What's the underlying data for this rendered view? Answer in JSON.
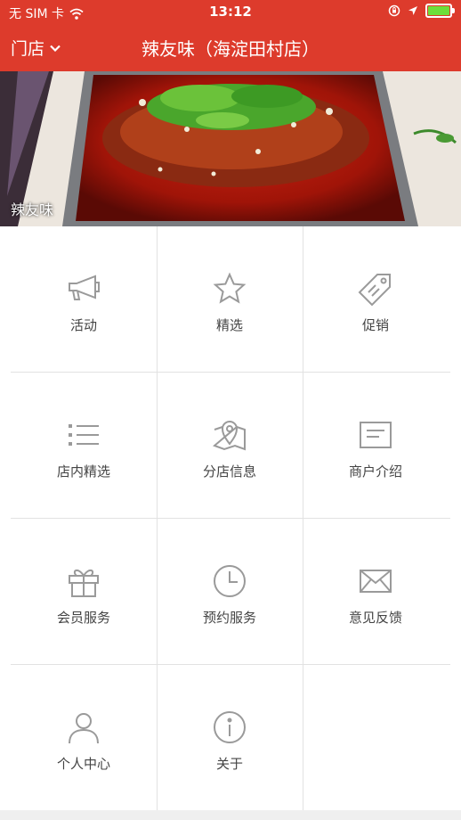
{
  "status_bar": {
    "carrier": "无 SIM 卡",
    "time": "13:12"
  },
  "nav": {
    "store_label": "门店",
    "title": "辣友味（海淀田村店）"
  },
  "banner": {
    "caption": "辣友味"
  },
  "menu": [
    {
      "label": "活动",
      "icon": "megaphone-icon"
    },
    {
      "label": "精选",
      "icon": "star-icon"
    },
    {
      "label": "促销",
      "icon": "tag-icon"
    },
    {
      "label": "店内精选",
      "icon": "list-icon"
    },
    {
      "label": "分店信息",
      "icon": "map-pin-icon"
    },
    {
      "label": "商户介绍",
      "icon": "document-icon"
    },
    {
      "label": "会员服务",
      "icon": "gift-icon"
    },
    {
      "label": "预约服务",
      "icon": "clock-icon"
    },
    {
      "label": "意见反馈",
      "icon": "envelope-icon"
    },
    {
      "label": "个人中心",
      "icon": "user-icon"
    },
    {
      "label": "关于",
      "icon": "info-icon"
    }
  ],
  "colors": {
    "accent": "#dd3b2c",
    "icon": "#9a9a9a",
    "battery": "#6dde3a"
  }
}
